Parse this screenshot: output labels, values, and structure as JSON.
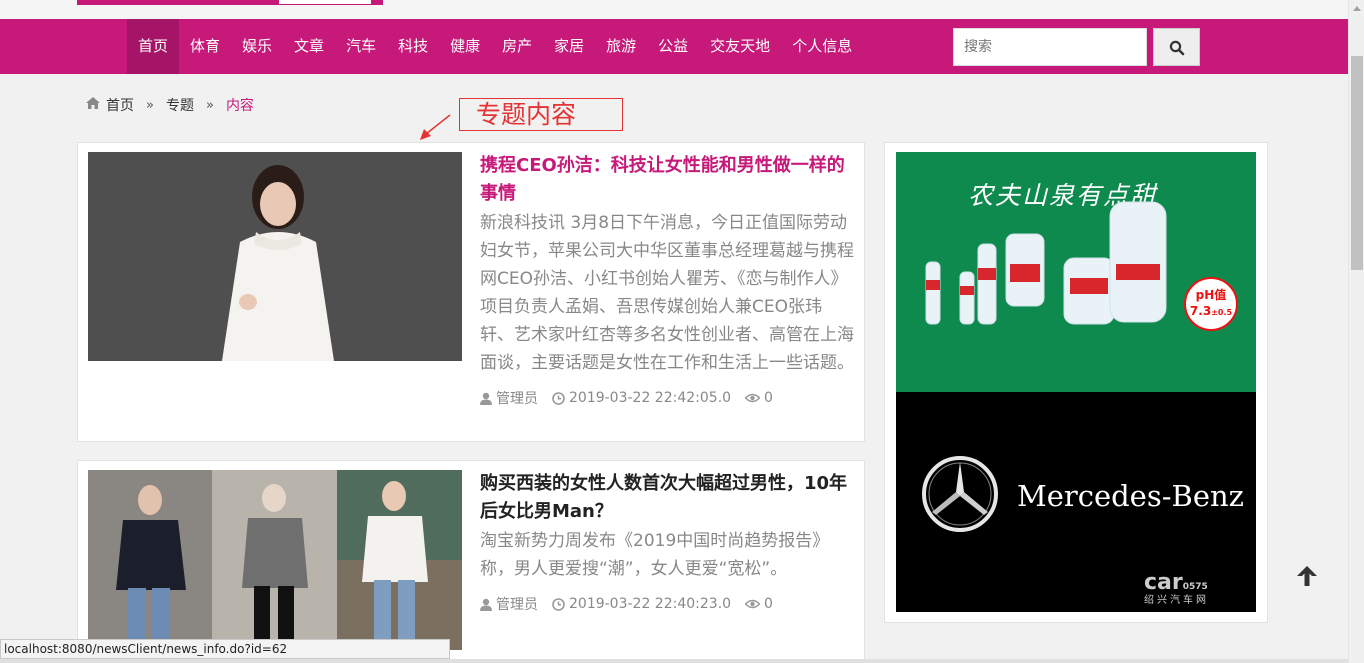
{
  "nav": {
    "items": [
      {
        "label": "首页",
        "active": true
      },
      {
        "label": "体育"
      },
      {
        "label": "娱乐"
      },
      {
        "label": "文章"
      },
      {
        "label": "汽车"
      },
      {
        "label": "科技"
      },
      {
        "label": "健康"
      },
      {
        "label": "房产"
      },
      {
        "label": "家居"
      },
      {
        "label": "旅游"
      },
      {
        "label": "公益"
      },
      {
        "label": "交友天地"
      },
      {
        "label": "个人信息"
      }
    ],
    "search_placeholder": "搜索",
    "search_icon": "magnifier-icon",
    "accent_color": "#c6197a"
  },
  "breadcrumb": {
    "home": "首页",
    "separator": "»",
    "section": "专题",
    "current": "内容"
  },
  "annotation": {
    "label": "专题内容",
    "color": "#e53333"
  },
  "articles": [
    {
      "title": "携程CEO孙洁：科技让女性能和男性做一样的事情",
      "summary": "新浪科技讯 3月8日下午消息，今日正值国际劳动妇女节，苹果公司大中华区董事总经理葛越与携程网CEO孙洁、小红书创始人瞿芳、《恋与制作人》项目负责人孟娟、吾思传媒创始人兼CEO张玮轩、艺术家叶红杏等多名女性创业者、高管在上海面谈，主要话题是女性在工作和生活上一些话题。",
      "author": "管理员",
      "date": "2019-03-22 22:42:05.0",
      "views": "0"
    },
    {
      "title": "购买西装的女性人数首次大幅超过男性，10年后女比男Man？",
      "summary": "淘宝新势力周发布《2019中国时尚趋势报告》称，男人更爱搜“潮”，女人更爱“宽松”。",
      "author": "管理员",
      "date": "2019-03-22 22:40:23.0",
      "views": "0"
    }
  ],
  "ads": {
    "water": {
      "slogan": "农夫山泉有点甜",
      "ph_label": "pH值",
      "ph_value": "7.3",
      "ph_range": "±0.5"
    },
    "benz": {
      "brand": "Mercedes-Benz",
      "site_logo": "car",
      "site_num": "0575",
      "site_name": "绍兴汽车网"
    }
  },
  "status_url": "localhost:8080/newsClient/news_info.do?id=62"
}
